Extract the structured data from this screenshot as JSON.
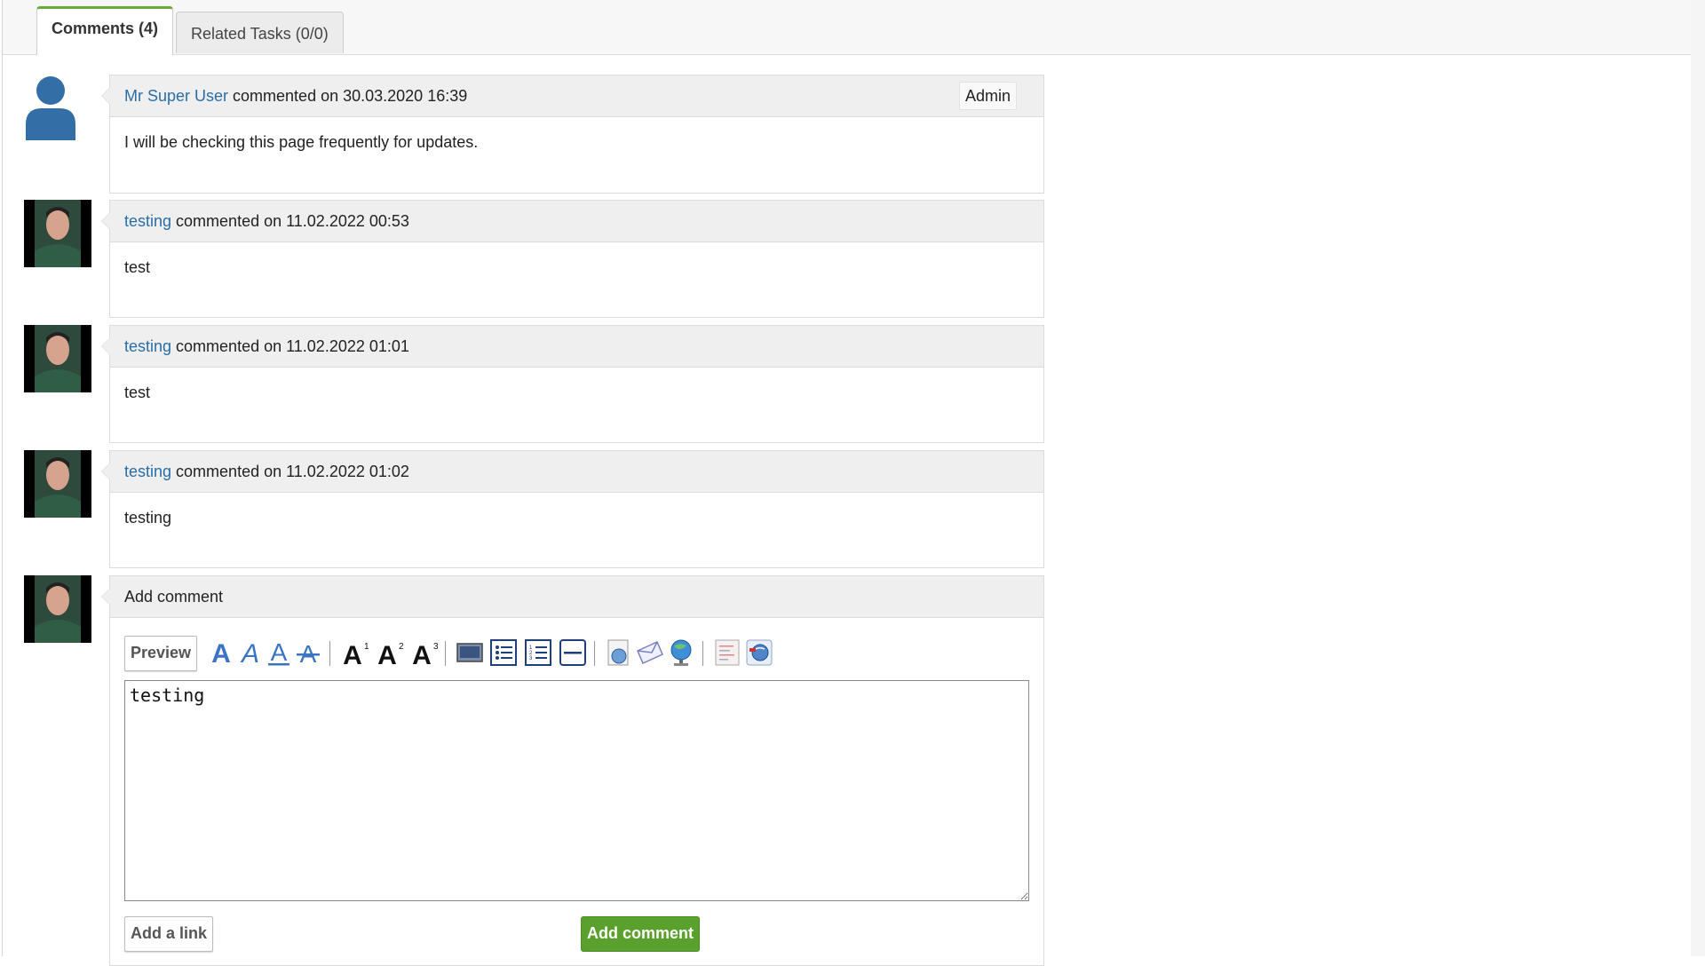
{
  "tabs": [
    {
      "label": "Comments (4)",
      "active": true
    },
    {
      "label": "Related Tasks (0/0)",
      "active": false
    }
  ],
  "comments": [
    {
      "author": "Mr Super User",
      "meta": " commented on 30.03.2020 16:39",
      "badge": "Admin",
      "text": "I will be checking this page frequently for updates.",
      "avatar": "default-user-icon"
    },
    {
      "author": "testing",
      "meta": " commented on 11.02.2022 00:53",
      "text": "test",
      "avatar": "user-photo"
    },
    {
      "author": "testing",
      "meta": " commented on 11.02.2022 01:01",
      "text": "test",
      "avatar": "user-photo"
    },
    {
      "author": "testing",
      "meta": " commented on 11.02.2022 01:02",
      "text": "testing",
      "avatar": "user-photo"
    }
  ],
  "add_comment": {
    "title": "Add comment",
    "preview_label": "Preview",
    "text_value": "testing",
    "add_link_label": "Add a link",
    "submit_label": "Add comment"
  },
  "toolbar_icons": [
    "bold-icon",
    "italic-icon",
    "underline-icon",
    "strikethrough-icon",
    "heading1-icon",
    "heading2-icon",
    "heading3-icon",
    "image-icon",
    "bullet-list-icon",
    "numbered-list-icon",
    "horizontal-rule-icon",
    "web-link-icon",
    "email-link-icon",
    "internet-link-icon",
    "code-icon",
    "anchor-link-icon"
  ],
  "colors": {
    "link": "#2a6ea6",
    "tab_accent": "#6aaa3a",
    "submit": "#5aa02c",
    "avatar_blue": "#336fa6"
  }
}
